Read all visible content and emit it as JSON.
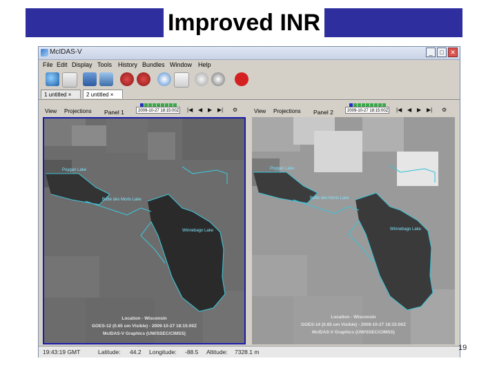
{
  "slide": {
    "title": "Improved INR",
    "page_number": "19"
  },
  "window": {
    "title": "McIDAS-V",
    "min_label": "_",
    "max_label": "□",
    "close_label": "✕"
  },
  "menu": [
    "File",
    "Edit",
    "Display",
    "Tools",
    "History",
    "Bundles",
    "Window",
    "Help"
  ],
  "toolbar": {
    "icons": [
      "globe-icon",
      "open-folder-icon",
      "layers-icon",
      "data-icon",
      "heart-icon",
      "heart-icon",
      "info-icon",
      "dialog-icon",
      "alert-icon",
      "capture-icon",
      "stop-icon"
    ]
  },
  "tabs": [
    {
      "label": "1 untitled",
      "close": "×",
      "active": false
    },
    {
      "label": "2 untitled",
      "close": "×",
      "active": true
    }
  ],
  "panels": [
    {
      "view_label": "View",
      "projections_label": "Projections",
      "name": "Panel 1",
      "time": "2009-10-27 18:15:00Z",
      "labels": {
        "lake1": "Poygan Lake",
        "lake2": "Butte des Morts Lake",
        "lake3": "Winnebago Lake"
      },
      "legend": [
        "Location - Wisconsin",
        "GOES-12 (0.65 um Visible) - 2009-10-27 18:15:00Z",
        "McIDAS-V Graphics (UW/SSEC/CIMSS)"
      ],
      "colors": {
        "land": "#6c6c6c",
        "lake": "#2a2a2a",
        "outline": "#3fc3d6"
      }
    },
    {
      "view_label": "View",
      "projections_label": "Projections",
      "name": "Panel 2",
      "time": "2009-10-27 18:15:00Z",
      "labels": {
        "lake1": "Poygan Lake",
        "lake2": "Butte des Morts Lake",
        "lake3": "Winnebago Lake"
      },
      "legend": [
        "Location - Wisconsin",
        "GOES-14 (0.65 um Visible) - 2009-10-27 18:15:00Z",
        "McIDAS-V Graphics (UW/SSEC/CIMSS)"
      ],
      "colors": {
        "land": "#9a9a9a",
        "lake": "#3a3a3a",
        "outline": "#3fc3d6"
      }
    }
  ],
  "status": {
    "time": "19:43:19 GMT",
    "lat_label": "Latitude:",
    "lat": "44.2",
    "lon_label": "Longitude:",
    "lon": "-88.5",
    "alt_label": "Altitude:",
    "alt": "7328.1 m"
  },
  "anim_controls": [
    "|◀",
    "◀",
    "▶",
    "▶|",
    "⚙"
  ]
}
